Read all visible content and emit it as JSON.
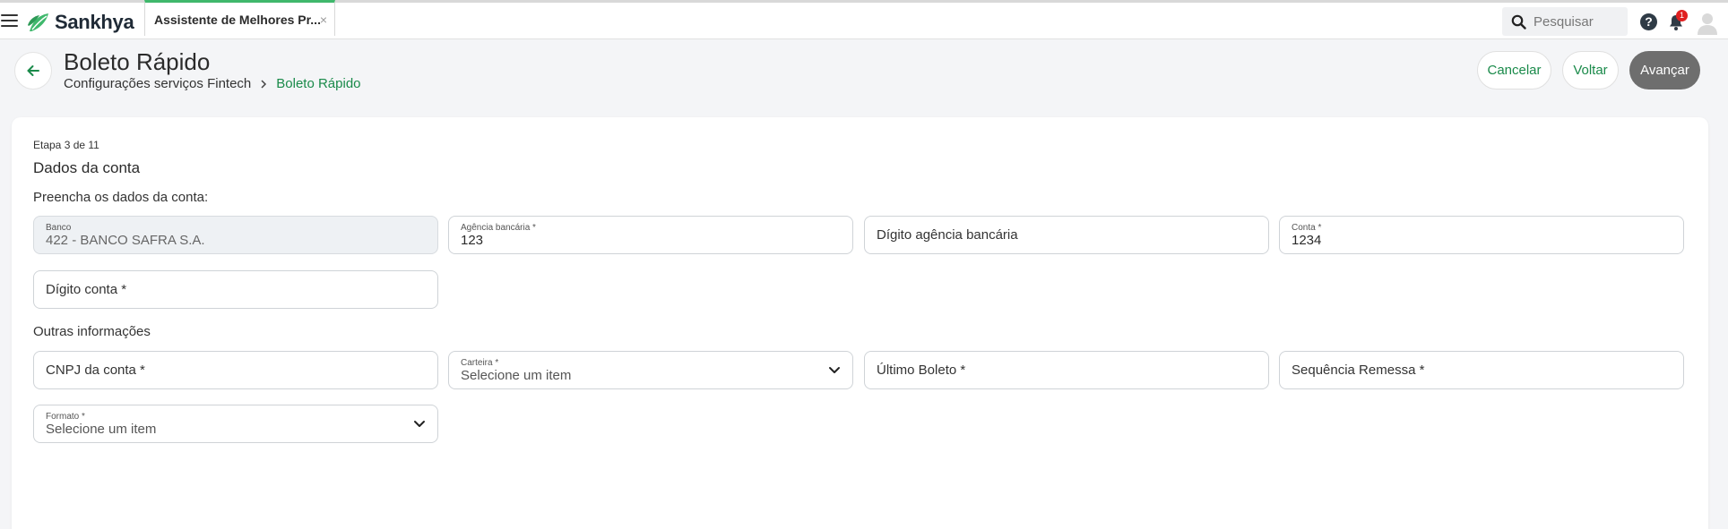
{
  "topbar": {
    "brand": "Sankhya",
    "tab_label": "Assistente de Melhores Pr...",
    "tab_close": "×",
    "search_placeholder": "Pesquisar",
    "help": "?",
    "notification_count": "1"
  },
  "header": {
    "title": "Boleto Rápido",
    "breadcrumb": [
      "Configurações serviços Fintech",
      "Boleto Rápido"
    ],
    "buttons": {
      "cancel": "Cancelar",
      "back": "Voltar",
      "next": "Avançar"
    }
  },
  "form": {
    "step": "Etapa 3 de 11",
    "section_title": "Dados da conta",
    "fill_label": "Preencha os dados da conta:",
    "other_label": "Outras informações",
    "fields": {
      "banco": {
        "label": "Banco",
        "value": "422 - BANCO SAFRA S.A."
      },
      "agencia": {
        "label": "Agência bancária *",
        "value": "123"
      },
      "digito_agencia": {
        "placeholder": "Dígito agência bancária"
      },
      "conta": {
        "label": "Conta *",
        "value": "1234"
      },
      "digito_conta": {
        "placeholder": "Dígito conta *"
      },
      "cnpj": {
        "placeholder": "CNPJ da conta *"
      },
      "carteira": {
        "label": "Carteira *",
        "value": "Selecione um item"
      },
      "ultimo_boleto": {
        "placeholder": "Último Boleto *"
      },
      "sequencia": {
        "placeholder": "Sequência Remessa *"
      },
      "formato": {
        "label": "Formato *",
        "value": "Selecione um item"
      }
    }
  },
  "colors": {
    "accent_green": "#1a8a4a",
    "primary_button": "#6e6e6e",
    "badge_red": "#e02020"
  }
}
